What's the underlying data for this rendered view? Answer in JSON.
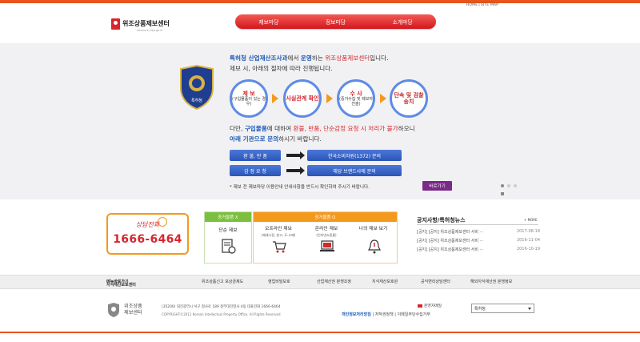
{
  "top_links": [
    "HOME",
    "SITE MAP"
  ],
  "logo": {
    "name": "위조상품제보센터",
    "sub": "adsmark.kipo.go.kr",
    "brand_color": "#d7262e"
  },
  "gnb": [
    "제보마당",
    "정보마당",
    "소개마당"
  ],
  "emblem": {
    "label": "특허청"
  },
  "intro": {
    "line1_a": "특허청 산업재산조사과",
    "line1_b": "에서 ",
    "line1_c": "운영",
    "line1_d": "하는 ",
    "line1_e": "위조상품제보센터",
    "line1_f": "입니다.",
    "line2": "제보 시, 아래의 절차에 따라 진행됩니다."
  },
  "steps": [
    {
      "title": "제 보",
      "desc": "(구입물품이 있는 경우)"
    },
    {
      "title": "사실관계 확인",
      "desc": ""
    },
    {
      "title": "수 사",
      "desc": "(증거수집 및 제보자 진술)"
    },
    {
      "title": "단속 및 검찰송치",
      "desc": ""
    }
  ],
  "para": {
    "a": "다만, ",
    "b": "구입물품",
    "c": "에 대하여 ",
    "d": "환불, 반품, 단순감정 요청 시 처리가 불가",
    "e": "하오니",
    "f": "아래 기관으로 문의",
    "g": "하시기 바랍니다."
  },
  "routes": [
    {
      "from": "환 불, 반 품",
      "to": "한국소비자원(1372) 문의"
    },
    {
      "from": "감 정 요 청",
      "to": "해당 브랜드사에 문의"
    }
  ],
  "notice": "* 제보 전 제보마당 이용안내 안내사항을 반드시 확인하여 주시기 바랍니다.",
  "shortcut_label": "바로가기",
  "phone": {
    "label": "상담전화",
    "number": "1666-6464"
  },
  "cards": [
    {
      "header": "증거물품 X",
      "title": "단순 제보",
      "sub": ""
    },
    {
      "header": "증거물품 O",
      "title": "오프라인 제보",
      "sub": "(재래시장, 창고, 도·소매)"
    },
    {
      "header": "",
      "title": "온라인 제보",
      "sub": "(인터넷쇼핑몰)"
    },
    {
      "header": "",
      "title": "나의 제보 보기",
      "sub": ""
    }
  ],
  "colors": {
    "green": "#7bbf3e",
    "orange": "#f39a1d",
    "blue": "#1b5ab8"
  },
  "news": {
    "title": "공지사항/특허청뉴스",
    "more": "+ MORE",
    "items": [
      {
        "text": "[공지] [공지] 위조상품제보센터 서비 ···",
        "date": "2017-08-18"
      },
      {
        "text": "[공지] [공지] 위조상품제보센터 서비 ···",
        "date": "2016-11-04"
      },
      {
        "text": "[공지] [공지] 위조상품제보센터 서비 ···",
        "date": "2016-10-19"
      }
    ]
  },
  "sitebar": {
    "head_a": "지식재산보호센터",
    "head_b": " 메뉴바로가기",
    "items": [
      "위조상품신고 포상금제도",
      "영업비밀보호",
      "산업재산권 분쟁조정",
      "지식재산보호원",
      "공익변리상담센터",
      "해외지식재산권 분쟁정보"
    ]
  },
  "footer": {
    "logo_line1": "위조상품",
    "logo_line2": "제보센터",
    "address": "(35200) 대전광역시 서구 청사로 189 정부대전청사 4동 대표전화 1666-6464",
    "copyright": "COPYRIGHT©2011 Korean Intellectual Property Office. All Rights Reserved",
    "mail": "운영자메일",
    "links": [
      "개인정보처리방침",
      "저작권정책",
      "이메일무단수집거부"
    ],
    "select_value": "특허청"
  }
}
